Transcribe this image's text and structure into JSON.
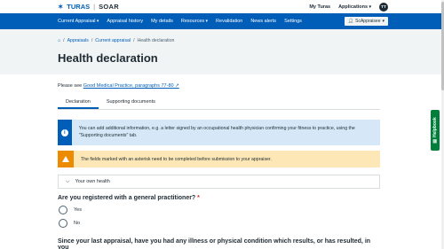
{
  "brand": {
    "name": "TURAS",
    "product": "SOAR"
  },
  "topbar": {
    "my_turas": "My Turas",
    "applications": "Applications",
    "avatar_initials": "TT"
  },
  "nav": {
    "items": [
      "Current Appraisal",
      "Appraisal history",
      "My details",
      "Resources",
      "Revalidation",
      "News alerts",
      "Settings"
    ],
    "role": "ScAppraisee"
  },
  "breadcrumb": {
    "appraisals": "Appraisals",
    "current": "Current appraisal",
    "page": "Health declaration"
  },
  "page_title": "Health declaration",
  "please_see": {
    "prefix": "Please see",
    "link": "Good Medical Practice, paragraphs 77-80"
  },
  "tabs": [
    "Declaration",
    "Supporting documents"
  ],
  "info_text": "You can add additional information, e.g. a letter signed by an occupational health physician confirming your fitness to practice, using the \"Supporting documents\" tab.",
  "warning_text": "The fields marked with an asterisk need to be completed before submission to your appraiser.",
  "accordion_label": "Your own health",
  "question1": {
    "text": "Are you registered with a general practitioner?",
    "required": "*",
    "options": [
      "Yes",
      "No"
    ]
  },
  "question2": "Since your last appraisal, have you had any illness or physical condition which results, or has resulted, in you",
  "helpbook": "Helpbook",
  "colors": {
    "primary": "#005eb8",
    "warning": "#ed8b00",
    "info_bg": "#d6e8f7",
    "warn_bg": "#fde7b6",
    "helpbook": "#007f3b"
  }
}
